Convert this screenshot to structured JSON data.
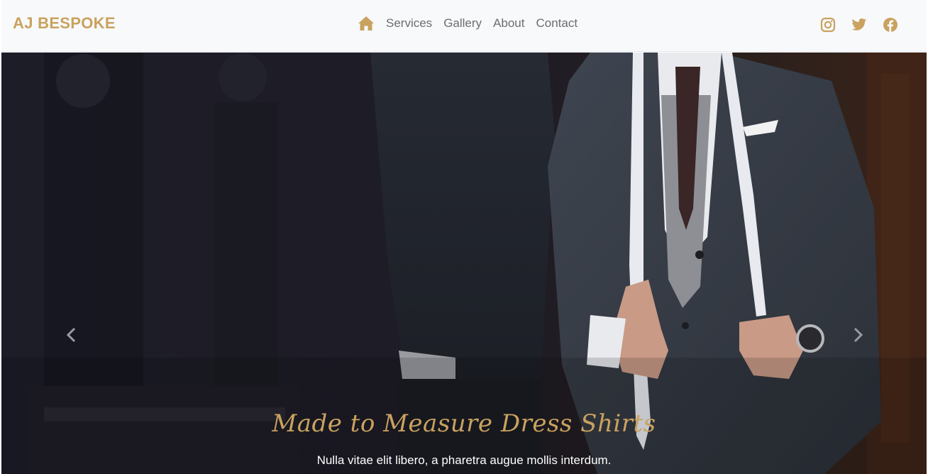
{
  "brand": {
    "name": "AJ BESPOKE",
    "color": "#c9a25f"
  },
  "nav": {
    "home_icon": "home-icon",
    "links": [
      "Services",
      "Gallery",
      "About",
      "Contact"
    ]
  },
  "social": {
    "icons": [
      "instagram-icon",
      "twitter-icon",
      "facebook-icon"
    ]
  },
  "hero": {
    "title": "Made to Measure Dress Shirts",
    "subtitle": "Nulla vitae elit libero, a pharetra augue mollis interdum.",
    "prev_icon": "chevron-left-icon",
    "next_icon": "chevron-right-icon"
  }
}
